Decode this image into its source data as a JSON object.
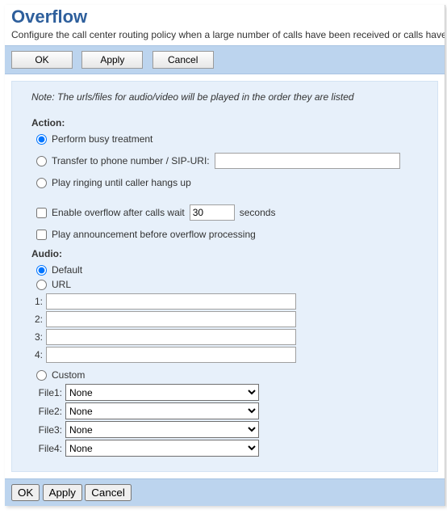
{
  "title": "Overflow",
  "description": "Configure the call center routing policy when a large number of calls have been received or calls have",
  "buttons": {
    "ok": "OK",
    "apply": "Apply",
    "cancel": "Cancel"
  },
  "note": "Note: The urls/files for audio/video will be played in the order they are listed",
  "action": {
    "label": "Action:",
    "busy": "Perform busy treatment",
    "transfer": "Transfer to phone number / SIP-URI:",
    "transfer_value": "",
    "ringing": "Play ringing until caller hangs up",
    "selected": "busy"
  },
  "overflow_wait": {
    "enable_label_pre": "Enable overflow after calls wait",
    "value": "30",
    "enable_label_post": "seconds",
    "enabled": false
  },
  "announcement": {
    "label": "Play announcement before overflow processing",
    "enabled": false
  },
  "audio": {
    "label": "Audio:",
    "default": "Default",
    "url": "URL",
    "custom": "Custom",
    "selected": "default",
    "urls": [
      {
        "num": "1:",
        "value": ""
      },
      {
        "num": "2:",
        "value": ""
      },
      {
        "num": "3:",
        "value": ""
      },
      {
        "num": "4:",
        "value": ""
      }
    ],
    "files": [
      {
        "label": "File1:",
        "value": "None"
      },
      {
        "label": "File2:",
        "value": "None"
      },
      {
        "label": "File3:",
        "value": "None"
      },
      {
        "label": "File4:",
        "value": "None"
      }
    ]
  }
}
